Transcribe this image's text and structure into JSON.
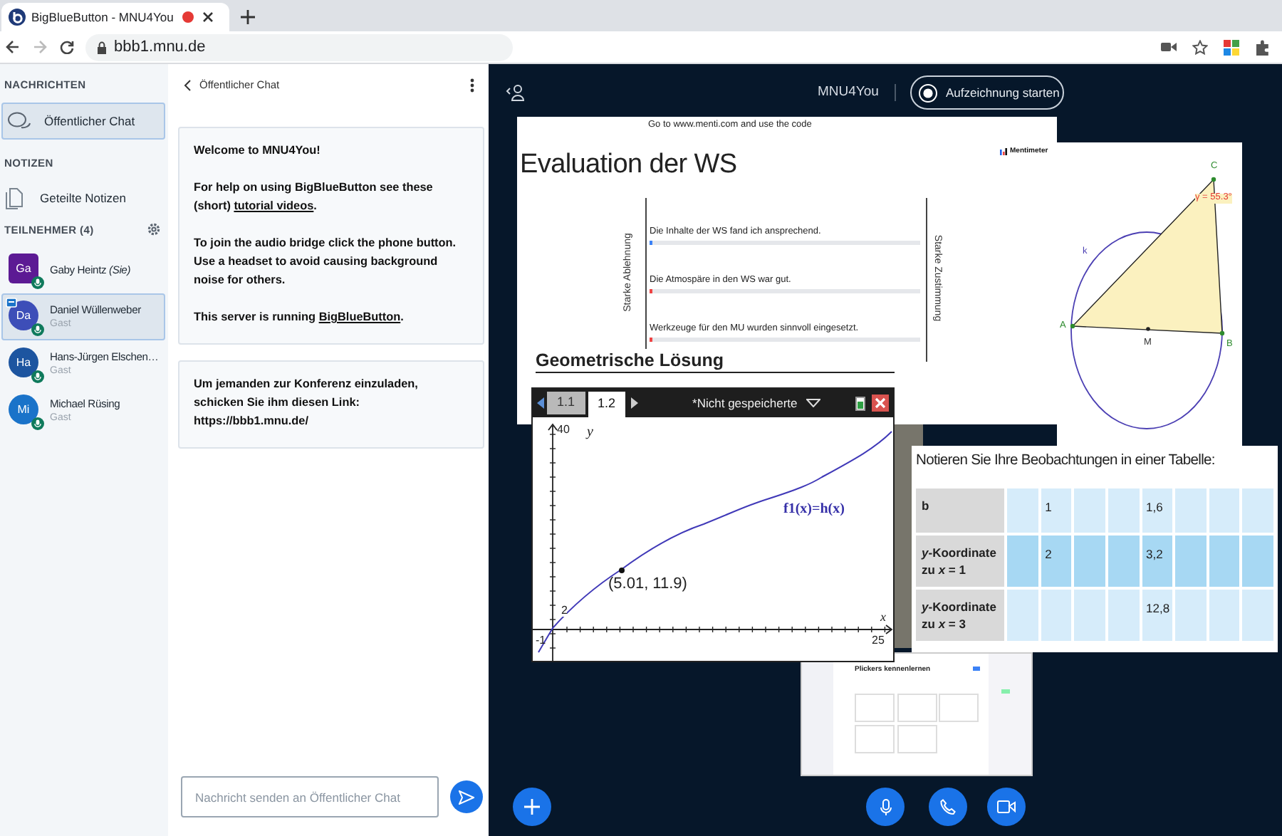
{
  "browser": {
    "tab": {
      "title": "BigBlueButton - MNU4You",
      "recording": true
    },
    "url": "bbb1.mnu.de"
  },
  "sidebar": {
    "messages_heading": "NACHRICHTEN",
    "chats": [
      {
        "label": "Öffentlicher Chat",
        "selected": true
      }
    ],
    "notes_heading": "NOTIZEN",
    "notes": [
      {
        "label": "Geteilte Notizen"
      }
    ],
    "participants_heading": "TEILNEHMER (4)",
    "participants": [
      {
        "initials": "Ga",
        "name": "Gaby Heintz *(Sie)*",
        "color": "#5c1a94",
        "moderator": true,
        "presenter": false,
        "selected": false
      },
      {
        "initials": "Da",
        "name": "Daniel Wüllenweber",
        "role": "Gast",
        "color": "#3d4eb8",
        "moderator": false,
        "presenter": true,
        "selected": true
      },
      {
        "initials": "Ha",
        "name": "Hans-Jürgen Elschen…",
        "role": "Gast",
        "color": "#1d55a0",
        "moderator": false,
        "presenter": false,
        "selected": false
      },
      {
        "initials": "Mi",
        "name": "Michael Rüsing",
        "role": "Gast",
        "color": "#1a73c9",
        "moderator": false,
        "presenter": false,
        "selected": false
      }
    ]
  },
  "chat": {
    "title": "Öffentlicher Chat",
    "messages": [
      {
        "paragraphs": [
          [
            {
              "kind": "text",
              "text": "Welcome to MNU4You!"
            }
          ],
          [
            {
              "kind": "text",
              "text": "For help on using BigBlueButton see these (short) "
            },
            {
              "kind": "link",
              "text": "tutorial videos"
            },
            {
              "kind": "text",
              "text": "."
            }
          ],
          [
            {
              "kind": "text",
              "text": "To join the audio bridge click the phone button. Use a headset to avoid causing background noise for others."
            }
          ],
          [
            {
              "kind": "text",
              "text": "This server is running "
            },
            {
              "kind": "link",
              "text": "BigBlueButton"
            },
            {
              "kind": "text",
              "text": "."
            }
          ]
        ]
      },
      {
        "paragraphs": [
          [
            {
              "kind": "text",
              "text": "Um jemanden zur Konferenz einzuladen, schicken Sie ihm diesen Link: "
            },
            {
              "kind": "url",
              "text": "https://bbb1.mnu.de/"
            }
          ]
        ]
      }
    ],
    "input": {
      "placeholder": "Nachricht senden an Öffentlicher Chat"
    }
  },
  "presentation": {
    "title": "MNU4You",
    "record_button": {
      "label": "Aufzeichnung starten",
      "recording": false
    },
    "menti": {
      "instruction": "Go to www.menti.com and use the code",
      "logo": "Mentimeter",
      "title": "Evaluation der WS",
      "scale_left": "Starke Ablehnung",
      "scale_right": "Starke Zustimmung",
      "statements": [
        {
          "text": "Die Inhalte der WS fand ich ansprechend.",
          "color": "#3b82f6"
        },
        {
          "text": "Die Atmospäre in den WS war gut.",
          "color": "#ef4444"
        },
        {
          "text": "Werkzeuge für den MU wurden sinnvoll eingesetzt.",
          "color": "#ef4444"
        }
      ]
    },
    "worksheet": {
      "heading": "Geometrische Lösung"
    },
    "geometry": {
      "vertices": [
        "A",
        "B",
        "C"
      ],
      "midpoint": "M",
      "circle_label": "k",
      "angle_label": "γ = 55.3°"
    },
    "calculator": {
      "tabs": [
        {
          "label": "1.1",
          "selected": false
        },
        {
          "label": "1.2",
          "selected": true
        }
      ],
      "document": "*Nicht gespeicherte",
      "graph": {
        "y_max": "40",
        "y_label": "y",
        "y_tick": "2",
        "x_min": "-1",
        "x_max": "25",
        "x_label": "x",
        "function": "f1(x)=h(x)",
        "point": "(5.01, 11.9)"
      }
    },
    "table_image": {
      "title": "Notieren Sie Ihre Beobachtungen in einer Tabelle:",
      "rows": [
        {
          "label": "b",
          "highlighted": false,
          "cells": [
            null,
            "1",
            null,
            null,
            "1,6",
            null,
            null,
            null
          ]
        },
        {
          "label": "*y*-Koordinate zu *x* = 1",
          "highlighted": true,
          "cells": [
            null,
            "2",
            null,
            null,
            "3,2",
            null,
            null,
            null
          ]
        },
        {
          "label": "*y*-Koordinate zu *x* = 3",
          "highlighted": false,
          "cells": [
            null,
            null,
            null,
            null,
            "12,8",
            null,
            null,
            null
          ]
        }
      ]
    },
    "plickers": {
      "title": "Plickers kennenlernen"
    }
  }
}
